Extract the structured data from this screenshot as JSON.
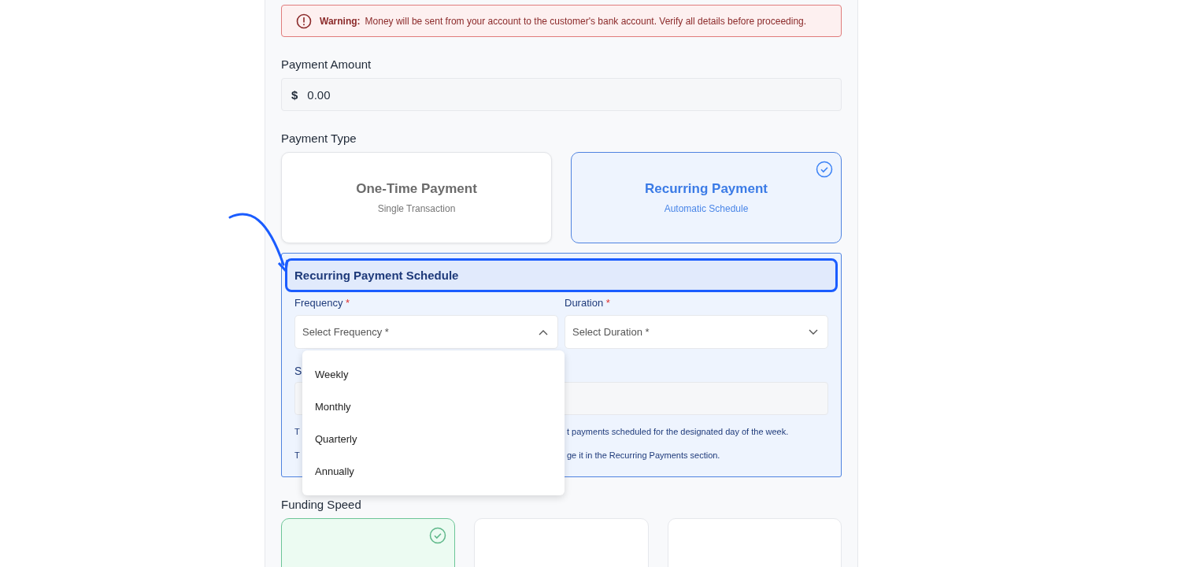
{
  "warning": {
    "label": "Warning:",
    "message": "Money will be sent from your account to the customer's bank account. Verify all details before proceeding."
  },
  "payment_amount": {
    "label": "Payment Amount",
    "currency": "$",
    "value": "0.00"
  },
  "payment_type": {
    "label": "Payment Type",
    "options": [
      {
        "title": "One-Time Payment",
        "subtitle": "Single Transaction",
        "selected": false
      },
      {
        "title": "Recurring Payment",
        "subtitle": "Automatic Schedule",
        "selected": true
      }
    ]
  },
  "schedule": {
    "title": "Recurring Payment Schedule",
    "fields": [
      {
        "label": "Frequency",
        "required_mark": "*",
        "placeholder": "Select Frequency *",
        "expanded": true
      },
      {
        "label": "Duration",
        "required_mark": "*",
        "placeholder": "Select Duration *",
        "expanded": false
      }
    ],
    "frequency_options": [
      "Weekly",
      "Monthly",
      "Quarterly",
      "Annually"
    ],
    "start_label": "S",
    "notes": [
      {
        "start": "T",
        "end": "t payments scheduled for the designated day of the week."
      },
      {
        "start": "T",
        "end": "ge it in the Recurring Payments section."
      }
    ]
  },
  "funding_speed": {
    "label": "Funding Speed",
    "options": [
      {
        "selected": true
      },
      {
        "selected": false
      },
      {
        "selected": false
      }
    ]
  }
}
